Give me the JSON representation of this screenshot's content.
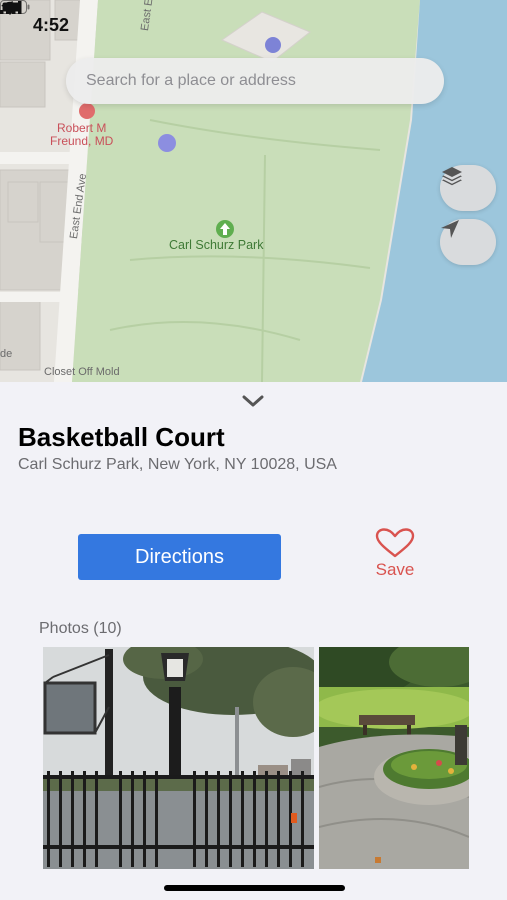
{
  "status": {
    "time": "4:52"
  },
  "search": {
    "placeholder": "Search for a place or address"
  },
  "map": {
    "labels": {
      "doctor": "Robert M\nFreund, MD",
      "park": "Carl Schurz Park",
      "street": "East End Ave",
      "street_top": "East E",
      "shop": "Closet Off Mold",
      "edge": "de"
    },
    "buttons": {
      "layers": "layers-icon",
      "locate": "location-arrow-icon"
    }
  },
  "place": {
    "title": "Basketball Court",
    "address": "Carl Schurz Park, New York, NY 10028, USA"
  },
  "actions": {
    "directions": "Directions",
    "save": "Save"
  },
  "photos": {
    "label": "Photos (10)"
  },
  "colors": {
    "accent": "#3478e0",
    "save": "#d9534f",
    "park": "#c7dfb9",
    "water": "#9dc6dd"
  }
}
